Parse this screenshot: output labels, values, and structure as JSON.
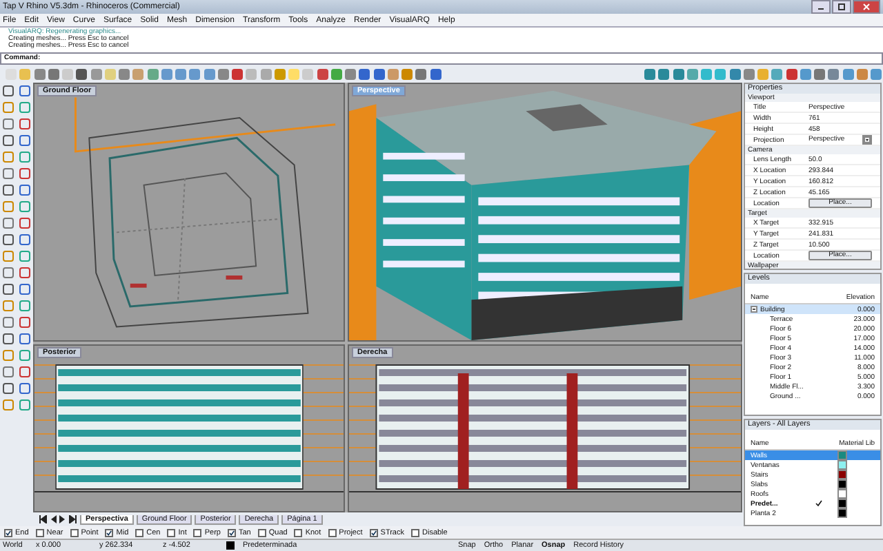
{
  "window": {
    "title": "Tap V Rhino V5.3dm - Rhinoceros (Commercial)"
  },
  "menu": [
    "File",
    "Edit",
    "View",
    "Curve",
    "Surface",
    "Solid",
    "Mesh",
    "Dimension",
    "Transform",
    "Tools",
    "Analyze",
    "Render",
    "VisualARQ",
    "Help"
  ],
  "command_history": [
    {
      "text": "VisualARQ: Regenerating graphics...",
      "kind": "info"
    },
    {
      "text": "Creating meshes... Press Esc to cancel",
      "kind": "plain"
    },
    {
      "text": "Creating meshes... Press Esc to cancel",
      "kind": "plain"
    }
  ],
  "command": {
    "label": "Command:"
  },
  "viewports": [
    {
      "title": "Ground Floor",
      "kind": "plan",
      "selected": false
    },
    {
      "title": "Perspective",
      "kind": "perspective",
      "selected": true
    },
    {
      "title": "Posterior",
      "kind": "elevation",
      "selected": false
    },
    {
      "title": "Derecha",
      "kind": "elevation",
      "selected": false
    }
  ],
  "viewport_tabs": [
    {
      "label": "Perspectiva",
      "selected": true
    },
    {
      "label": "Ground Floor",
      "selected": false
    },
    {
      "label": "Posterior",
      "selected": false
    },
    {
      "label": "Derecha",
      "selected": false
    },
    {
      "label": "Página 1",
      "selected": false
    }
  ],
  "properties": {
    "title": "Properties",
    "sections": [
      {
        "title": "Viewport",
        "rows": [
          {
            "label": "Title",
            "value": "Perspective",
            "kind": "text"
          },
          {
            "label": "Width",
            "value": "761",
            "kind": "text"
          },
          {
            "label": "Height",
            "value": "458",
            "kind": "text"
          },
          {
            "label": "Projection",
            "value": "Perspective",
            "kind": "dropdown"
          }
        ]
      },
      {
        "title": "Camera",
        "rows": [
          {
            "label": "Lens Length",
            "value": "50.0",
            "kind": "text"
          },
          {
            "label": "X Location",
            "value": "293.844",
            "kind": "text"
          },
          {
            "label": "Y Location",
            "value": "160.812",
            "kind": "text"
          },
          {
            "label": "Z Location",
            "value": "45.165",
            "kind": "text"
          },
          {
            "label": "Location",
            "value": "Place...",
            "kind": "button"
          }
        ]
      },
      {
        "title": "Target",
        "rows": [
          {
            "label": "X Target",
            "value": "332.915",
            "kind": "text"
          },
          {
            "label": "Y Target",
            "value": "241.831",
            "kind": "text"
          },
          {
            "label": "Z Target",
            "value": "10.500",
            "kind": "text"
          },
          {
            "label": "Location",
            "value": "Place...",
            "kind": "button"
          }
        ]
      },
      {
        "title": "Wallpaper"
      }
    ]
  },
  "levels": {
    "title": "Levels",
    "columns": [
      "Name",
      "Elevation"
    ],
    "items": [
      {
        "name": "Building",
        "elevation": "0.000",
        "expanded": true,
        "selected": true,
        "children": [
          {
            "name": "Terrace",
            "elevation": "23.000",
            "selected": false
          },
          {
            "name": "Floor 6",
            "elevation": "20.000",
            "selected": false
          },
          {
            "name": "Floor 5",
            "elevation": "17.000",
            "selected": false
          },
          {
            "name": "Floor 4",
            "elevation": "14.000",
            "selected": false
          },
          {
            "name": "Floor 3",
            "elevation": "11.000",
            "selected": false
          },
          {
            "name": "Floor 2",
            "elevation": "8.000",
            "selected": false
          },
          {
            "name": "Floor 1",
            "elevation": "5.000",
            "selected": false
          },
          {
            "name": "Middle Fl...",
            "elevation": "3.300",
            "selected": false
          },
          {
            "name": "Ground ...",
            "elevation": "0.000",
            "selected": false
          }
        ]
      }
    ]
  },
  "layers": {
    "title": "Layers - All Layers",
    "columns": [
      "Name",
      "Material Lib"
    ],
    "rows": [
      {
        "name": "Walls",
        "selected": true,
        "current": false,
        "color": "#1a8a80"
      },
      {
        "name": "Ventanas",
        "selected": false,
        "current": false,
        "color": "#8ef0f0"
      },
      {
        "name": "Stairs",
        "selected": false,
        "current": false,
        "color": "#8b0000"
      },
      {
        "name": "Slabs",
        "selected": false,
        "current": false,
        "color": "#000000"
      },
      {
        "name": "Roofs",
        "selected": false,
        "current": false,
        "color": "#ffffff"
      },
      {
        "name": "Predet...",
        "selected": false,
        "current": true,
        "color": "#000000"
      },
      {
        "name": "Planta 2",
        "selected": false,
        "current": false,
        "color": "#000000"
      }
    ]
  },
  "osnaps": [
    {
      "label": "End",
      "checked": true
    },
    {
      "label": "Near",
      "checked": false
    },
    {
      "label": "Point",
      "checked": false
    },
    {
      "label": "Mid",
      "checked": true
    },
    {
      "label": "Cen",
      "checked": false
    },
    {
      "label": "Int",
      "checked": false
    },
    {
      "label": "Perp",
      "checked": false
    },
    {
      "label": "Tan",
      "checked": true
    },
    {
      "label": "Quad",
      "checked": false
    },
    {
      "label": "Knot",
      "checked": false
    },
    {
      "label": "Project",
      "checked": false
    },
    {
      "label": "STrack",
      "checked": true
    },
    {
      "label": "Disable",
      "checked": false
    }
  ],
  "status_bar": {
    "cplane": "World",
    "x": "x 0.000",
    "y": "y 262.334",
    "z": "z -4.502",
    "layer": "Predeterminada",
    "toggles": [
      {
        "label": "Snap",
        "on": false
      },
      {
        "label": "Ortho",
        "on": false
      },
      {
        "label": "Planar",
        "on": false
      },
      {
        "label": "Osnap",
        "on": true
      },
      {
        "label": "Record History",
        "on": false
      }
    ]
  }
}
